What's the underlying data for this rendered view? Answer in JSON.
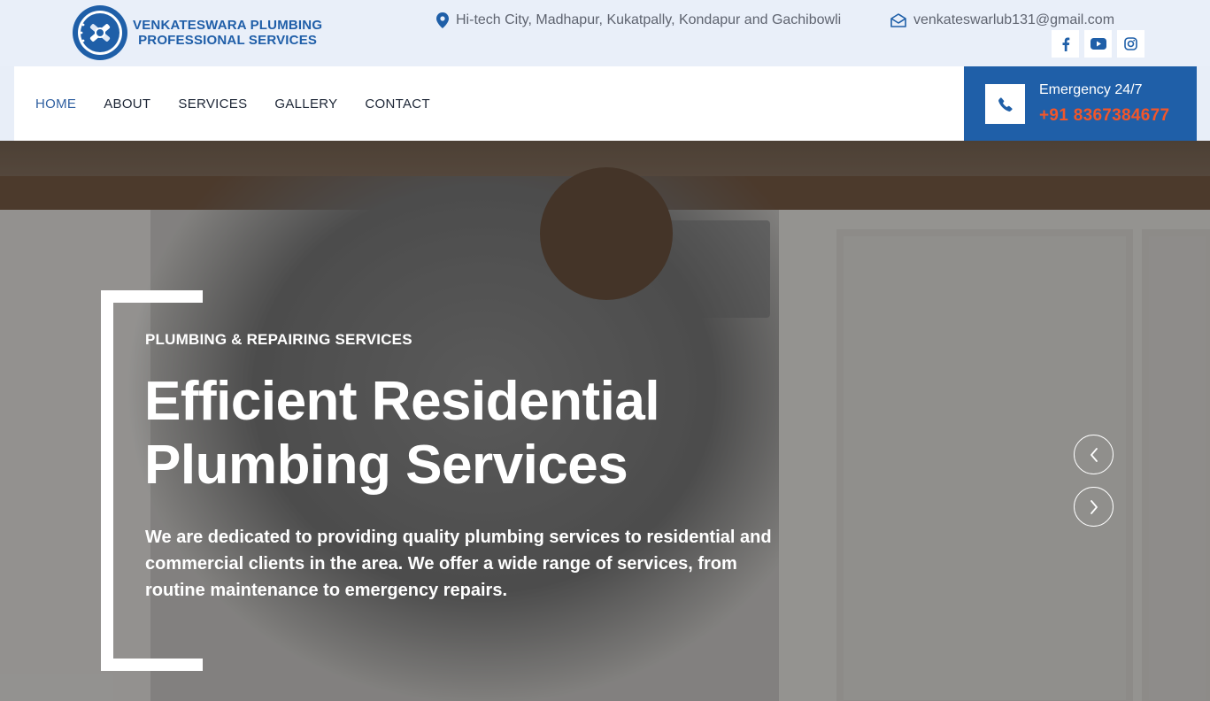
{
  "brand": {
    "line1": "VENKATESWARA PLUMBING",
    "line2": "PROFESSIONAL SERVICES",
    "logo_icon": "plumber-tools-logo-icon"
  },
  "topbar": {
    "address": "Hi-tech City, Madhapur, Kukatpally, Kondapur and Gachibowli",
    "email": "venkateswarlub131@gmail.com",
    "socials": [
      {
        "name": "facebook",
        "icon": "facebook-icon"
      },
      {
        "name": "youtube",
        "icon": "youtube-icon"
      },
      {
        "name": "instagram",
        "icon": "instagram-icon"
      }
    ]
  },
  "nav": {
    "items": [
      "HOME",
      "ABOUT",
      "SERVICES",
      "GALLERY",
      "CONTACT"
    ],
    "active": "HOME"
  },
  "emergency": {
    "label": "Emergency 24/7",
    "number": "+91 8367384677"
  },
  "hero": {
    "eyebrow": "PLUMBING & REPAIRING SERVICES",
    "headline": "Efficient Residential Plumbing Services",
    "description": "We are dedicated to providing quality plumbing services to residential and commercial clients in the area. We offer a wide range of services, from routine maintenance to emergency repairs."
  },
  "colors": {
    "brand_blue": "#1f5fa8",
    "accent_orange": "#f2562a",
    "topbar_bg": "#e9eff9"
  }
}
